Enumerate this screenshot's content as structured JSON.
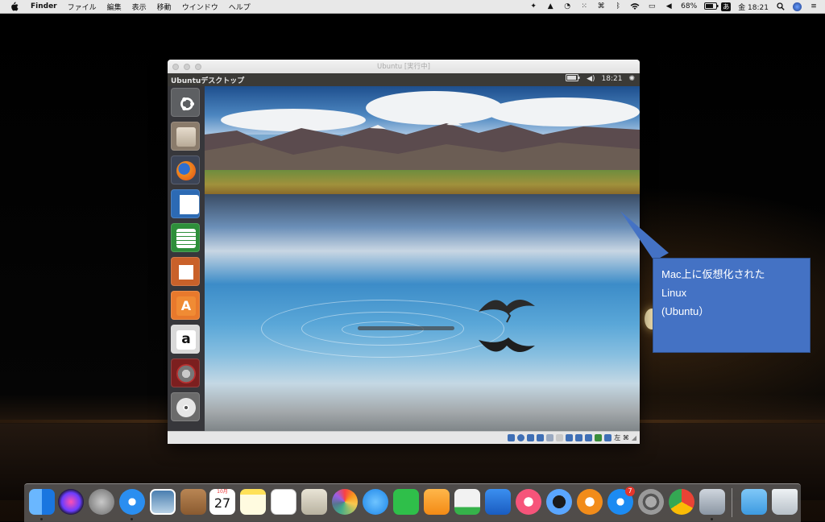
{
  "menubar": {
    "items": [
      "Finder",
      "ファイル",
      "編集",
      "表示",
      "移動",
      "ウインドウ",
      "ヘルプ"
    ],
    "battery": "68%",
    "input_mode": "あ",
    "clock": "金 18:21"
  },
  "vbox": {
    "title": "Ubuntu [実行中]",
    "status_keys": "左 ⌘"
  },
  "ubuntu": {
    "panel_label": "Ubuntuデスクトップ",
    "clock": "18:21",
    "launcher": [
      "ubuntu-logo",
      "files",
      "firefox",
      "libreoffice-writer",
      "libreoffice-calc",
      "libreoffice-impress",
      "ubuntu-software",
      "amazon",
      "system-settings",
      "dvd"
    ]
  },
  "callout": {
    "line1": "Mac上に仮想化された",
    "line2": "Linux",
    "line3": "(Ubuntu）"
  },
  "dock": {
    "items": [
      "finder",
      "siri",
      "launchpad",
      "safari",
      "preview-photos",
      "contacts",
      "calendar",
      "notes",
      "reminders",
      "preview",
      "photos",
      "messages",
      "facetime",
      "pages",
      "numbers",
      "keynote",
      "itunes",
      "quicktime",
      "ibooks",
      "app-store",
      "system-preferences",
      "chrome",
      "virtualbox",
      "downloads-folder",
      "trash"
    ],
    "calendar": {
      "month": "10月",
      "day": "27"
    },
    "app_store_badge": "7"
  },
  "colors": {
    "callout_fill": "#4472c4",
    "ubuntu_panel": "#3b3a37",
    "launcher_bg": "#28282c"
  }
}
